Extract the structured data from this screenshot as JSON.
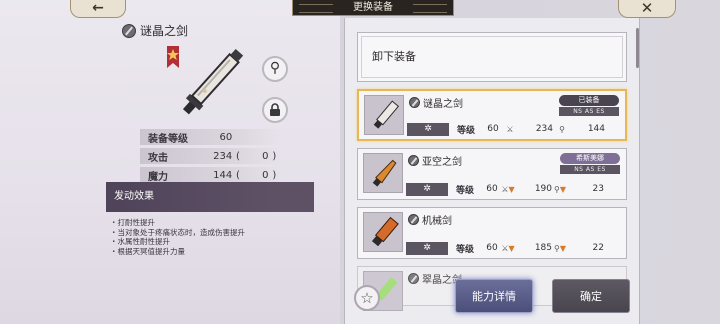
{
  "header": {
    "title": "更换装备",
    "back_icon": "arrow-left-icon",
    "close_icon": "close-icon"
  },
  "weapon_detail": {
    "name": "谜晶之剑",
    "rank_icon": "rank-star-badge-icon",
    "stats": [
      {
        "label": "装备等级",
        "value": "60",
        "open": "",
        "bonus": "",
        "close": ""
      },
      {
        "label": "攻击",
        "value": "234",
        "open": "(",
        "bonus": "0",
        "close": ")"
      },
      {
        "label": "魔力",
        "value": "144",
        "open": "(",
        "bonus": "0",
        "close": ")"
      }
    ],
    "effect_title": "发动效果",
    "effects": [
      "・打耐性提升",
      "・当对象处于疼痛状态时，造成伤害提升",
      "・水属性耐性提升",
      "・根据天冥值提升力量"
    ]
  },
  "list": {
    "unequip_label": "卸下装备",
    "items": [
      {
        "name": "谜晶之剑",
        "badge": "已装备",
        "ns": "NS  AS  ES",
        "stars": "✲",
        "level_label": "等级",
        "level": "60",
        "atk": "234",
        "mag": "144",
        "atk_down": false,
        "mag_down": false
      },
      {
        "name": "亚空之剑",
        "badge": "希斯美娜",
        "ns": "NS  AS  ES",
        "stars": "✲",
        "level_label": "等级",
        "level": "60",
        "atk": "190",
        "mag": "23",
        "atk_down": true,
        "mag_down": true
      },
      {
        "name": "机械剑",
        "badge": "",
        "ns": "",
        "stars": "✲",
        "level_label": "等级",
        "level": "60",
        "atk": "185",
        "mag": "22",
        "atk_down": true,
        "mag_down": true
      },
      {
        "name": "翠晶之剑",
        "badge": "",
        "ns": "",
        "stars": "✲",
        "level_label": "",
        "level": "",
        "atk": "",
        "mag": "",
        "atk_down": false,
        "mag_down": false
      }
    ]
  },
  "buttons": {
    "detail_label": "能力详情",
    "confirm_label": "确定",
    "favorite_icon": "star-icon"
  },
  "colors": {
    "selected_border": "#e7b655",
    "arrow_down": "#d77a2a",
    "effect_header": "#4f4359"
  }
}
